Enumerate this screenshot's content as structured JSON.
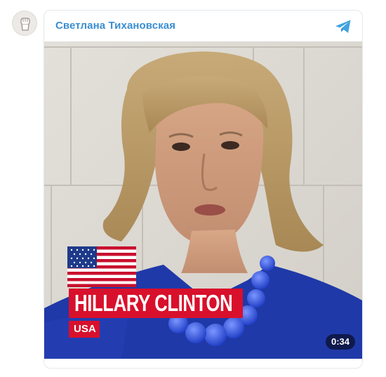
{
  "post": {
    "channel_name": "Светлана Тихановская",
    "avatar_icon": "raised-fist-icon",
    "share_icon": "telegram-icon",
    "accent_color": "#3a8ed1"
  },
  "video": {
    "overlay_name": "HILLARY CLINTON",
    "overlay_country": "USA",
    "overlay_flag": "us-flag-icon",
    "overlay_color": "#d8102c",
    "duration": "0:34"
  }
}
